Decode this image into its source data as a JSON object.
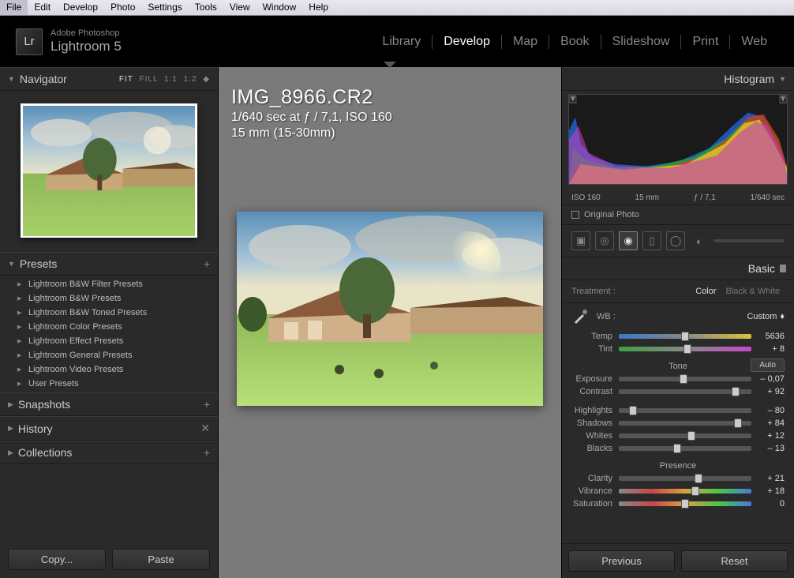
{
  "menu": {
    "file": "File",
    "edit": "Edit",
    "develop": "Develop",
    "photo": "Photo",
    "settings": "Settings",
    "tools": "Tools",
    "view": "View",
    "window": "Window",
    "help": "Help"
  },
  "app": {
    "brand": "Adobe Photoshop",
    "product": "Lightroom 5",
    "badge": "Lr"
  },
  "modules": {
    "library": "Library",
    "develop": "Develop",
    "map": "Map",
    "book": "Book",
    "slideshow": "Slideshow",
    "print": "Print",
    "web": "Web"
  },
  "navigator": {
    "title": "Navigator",
    "zoom": {
      "fit": "FIT",
      "fill": "FILL",
      "one": "1:1",
      "two": "1:2"
    }
  },
  "presets": {
    "title": "Presets",
    "items": [
      "Lightroom B&W Filter Presets",
      "Lightroom B&W Presets",
      "Lightroom B&W Toned Presets",
      "Lightroom Color Presets",
      "Lightroom Effect Presets",
      "Lightroom General Presets",
      "Lightroom Video Presets",
      "User Presets"
    ]
  },
  "panels": {
    "snapshots": "Snapshots",
    "history": "History",
    "collections": "Collections"
  },
  "leftButtons": {
    "copy": "Copy...",
    "paste": "Paste"
  },
  "file": {
    "name": "IMG_8966.CR2",
    "exposure": "1/640 sec at ƒ / 7,1, ISO 160",
    "lens": "15 mm (15-30mm)"
  },
  "histogram": {
    "title": "Histogram",
    "iso": "ISO 160",
    "focal": "15 mm",
    "aperture": "ƒ / 7,1",
    "shutter": "1/640 sec",
    "original": "Original Photo"
  },
  "basic": {
    "title": "Basic",
    "treatment": {
      "label": "Treatment :",
      "color": "Color",
      "bw": "Black & White"
    },
    "wb": {
      "label": "WB :",
      "value": "Custom"
    },
    "temp": {
      "label": "Temp",
      "value": "5636",
      "pos": 50
    },
    "tint": {
      "label": "Tint",
      "value": "+ 8",
      "pos": 52
    },
    "tone": {
      "title": "Tone",
      "auto": "Auto"
    },
    "exposure": {
      "label": "Exposure",
      "value": "– 0,07",
      "pos": 49
    },
    "contrast": {
      "label": "Contrast",
      "value": "+ 92",
      "pos": 88
    },
    "highlights": {
      "label": "Highlights",
      "value": "– 80",
      "pos": 11
    },
    "shadows": {
      "label": "Shadows",
      "value": "+ 84",
      "pos": 90
    },
    "whites": {
      "label": "Whites",
      "value": "+ 12",
      "pos": 55
    },
    "blacks": {
      "label": "Blacks",
      "value": "– 13",
      "pos": 44
    },
    "presence": {
      "title": "Presence"
    },
    "clarity": {
      "label": "Clarity",
      "value": "+ 21",
      "pos": 60
    },
    "vibrance": {
      "label": "Vibrance",
      "value": "+ 18",
      "pos": 58
    },
    "saturation": {
      "label": "Saturation",
      "value": "0",
      "pos": 50
    }
  },
  "rightButtons": {
    "previous": "Previous",
    "reset": "Reset"
  }
}
